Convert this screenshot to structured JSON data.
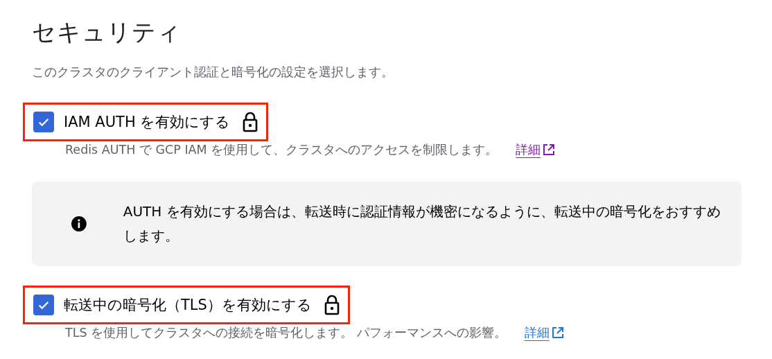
{
  "title": "セキュリティ",
  "description": "このクラスタのクライアント認証と暗号化の設定を選択します。",
  "options": [
    {
      "kind": "checkbox",
      "label": "IAM AUTH を有効にする",
      "checked": true,
      "highlighted": true,
      "locked": true,
      "help": "Redis AUTH で GCP IAM を使用して、クラスタへのアクセスを制限します。",
      "link": {
        "label": "詳細",
        "visited": true
      },
      "notice": "AUTH を有効にする場合は、転送時に認証情報が機密になるように、転送中の暗号化をおすすめします。"
    },
    {
      "kind": "checkbox",
      "label": "転送中の暗号化（TLS）を有効にする",
      "checked": true,
      "highlighted": true,
      "locked": true,
      "help": "TLS を使用してクラスタへの接続を暗号化します。 パフォーマンスへの影響。",
      "link": {
        "label": "詳細",
        "visited": false
      }
    }
  ]
}
